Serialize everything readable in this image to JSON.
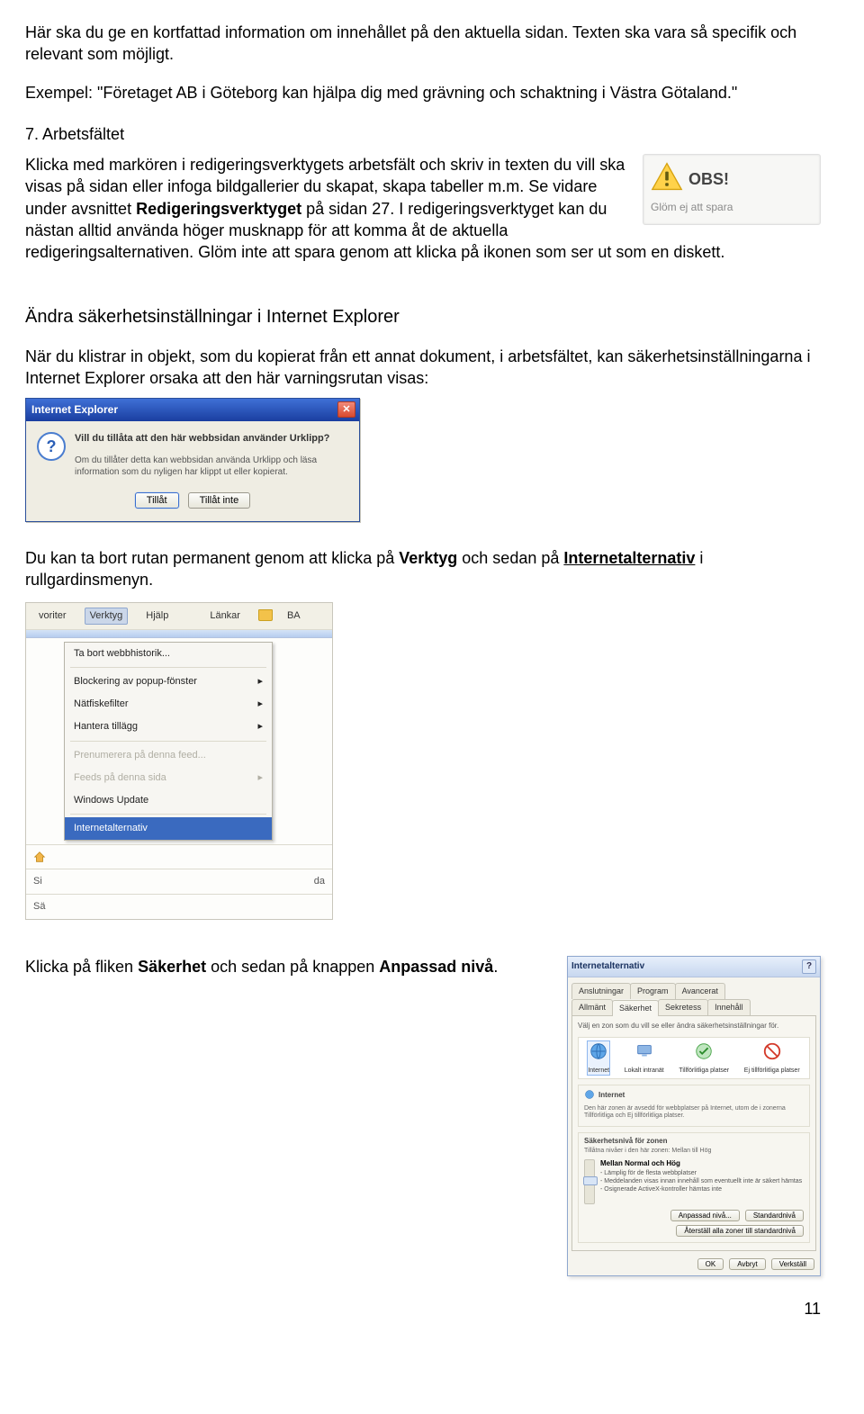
{
  "intro": {
    "p1": "Här ska du ge en kortfattad information om innehållet på den aktuella sidan. Texten ska vara så specifik och relevant som möjligt.",
    "p2": "Exempel: \"Företaget AB i Göteborg kan hjälpa dig med grävning och schaktning i Västra Götaland.\""
  },
  "sec7": {
    "heading": "7. Arbetsfältet",
    "t1": "Klicka med markören i redigeringsverktygets arbetsfält och skriv in texten du vill ska visas på sidan eller infoga bildgallerier du skapat, skapa tabeller m.m. Se vidare under avsnittet ",
    "bold1": "Redigeringsverktyget",
    "t2": " på sidan 27. I redigeringsverktyget kan du nästan alltid använda höger musknapp för att komma åt de aktuella redigeringsalternativen. Glöm inte att spara genom att klicka på ikonen som ser ut som en diskett."
  },
  "obs": {
    "title": "OBS!",
    "subtitle": "Glöm ej att spara"
  },
  "sec_ie": {
    "heading": "Ändra säkerhetsinställningar i Internet Explorer",
    "p1": "När du klistrar in objekt, som du kopierat från ett annat dokument, i arbetsfältet, kan säkerhetsinställningarna i Internet Explorer orsaka att den här varningsrutan visas:"
  },
  "ie_dialog": {
    "title": "Internet Explorer",
    "question": "Vill du tillåta att den här webbsidan använder Urklipp?",
    "desc": "Om du tillåter detta kan webbsidan använda Urklipp och läsa information som du nyligen har klippt ut eller kopierat.",
    "btn_allow": "Tillåt",
    "btn_deny": "Tillåt inte"
  },
  "remove_box": {
    "t1": "Du kan ta bort rutan permanent genom att klicka på ",
    "b1": "Verktyg",
    "t2": " och sedan på ",
    "b2": "Internetalternativ",
    "t3": " i rullgardinsmenyn."
  },
  "menu": {
    "toolbar": {
      "favorites": "voriter",
      "tools": "Verktyg",
      "help": "Hjälp",
      "links": "Länkar",
      "folder": "BA"
    },
    "items": {
      "history": "Ta bort webbhistorik...",
      "popup": "Blockering av popup-fönster",
      "phish": "Nätfiskefilter",
      "addons": "Hantera tillägg",
      "feed_sub": "Prenumerera på denna feed...",
      "feeds": "Feeds på denna sida",
      "winupd": "Windows Update",
      "inetopt": "Internetalternativ"
    },
    "side": {
      "si": "Si",
      "sa": "Sä",
      "da": "da"
    }
  },
  "click_tab": {
    "t1": "Klicka på fliken ",
    "b1": "Säkerhet",
    "t2": " och sedan på knappen ",
    "b2": "Anpassad nivå",
    "t3": "."
  },
  "ia": {
    "title": "Internetalternativ",
    "tabs_row1": [
      "Anslutningar",
      "Program",
      "Avancerat"
    ],
    "tabs_row2": [
      "Allmänt",
      "Säkerhet",
      "Sekretess",
      "Innehåll"
    ],
    "zone_desc": "Välj en zon som du vill se eller ändra säkerhetsinställningar för.",
    "zones": [
      "Internet",
      "Lokalt intranät",
      "Tillförlitliga platser",
      "Ej tillförlitliga platser"
    ],
    "group_internet": "Internet",
    "group_internet_desc": "Den här zonen är avsedd för webbplatser på Internet, utom de i zonerna Tillförlitliga och Ej tillförlitliga platser.",
    "level_group": "Säkerhetsnivå för zonen",
    "level_desc": "Tillåtna nivåer i den här zonen: Mellan till Hög",
    "level_name": "Mellan Normal och Hög",
    "bullets": [
      "Lämplig för de flesta webbplatser",
      "Meddelanden visas innan innehåll som eventuellt inte är säkert hämtas",
      "Osignerade ActiveX-kontroller hämtas inte"
    ],
    "btn_custom": "Anpassad nivå...",
    "btn_default": "Standardnivå",
    "btn_reset": "Återställ alla zoner till standardnivå",
    "btn_ok": "OK",
    "btn_cancel": "Avbryt",
    "btn_apply": "Verkställ"
  },
  "page_number": "11"
}
